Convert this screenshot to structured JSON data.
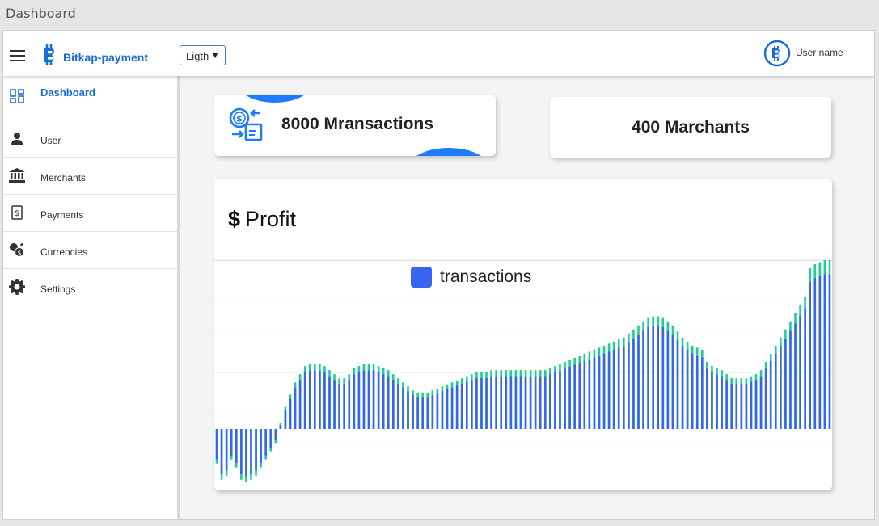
{
  "window": {
    "title": "Dashboard"
  },
  "header": {
    "brand": "Bitkap-payment",
    "theme_select": "Ligth",
    "user_name": "User name"
  },
  "sidebar": {
    "items": [
      {
        "label": "Dashboard",
        "icon": "dashboard-icon",
        "active": true
      },
      {
        "label": "User",
        "icon": "user-icon"
      },
      {
        "label": "Merchants",
        "icon": "bank-icon"
      },
      {
        "label": "Payments",
        "icon": "dollar-bill-icon"
      },
      {
        "label": "Currencies",
        "icon": "currency-exchange-icon"
      },
      {
        "label": "Settings",
        "icon": "gear-icon"
      }
    ]
  },
  "cards": {
    "transactions": "8000 Mransactions",
    "merchants": "400 Marchants"
  },
  "colors": {
    "accent": "#1a6fd6",
    "series_blue": "#3765f2",
    "series_green": "#1fcf8f"
  },
  "chart_data": {
    "type": "bar",
    "title": "Profit",
    "title_prefix": "$",
    "legend": {
      "label": "transactions",
      "position": "top-center"
    },
    "grid": true,
    "ylim": [
      -1.5,
      4.5
    ],
    "series": [
      {
        "name": "transactions",
        "values": [
          -0.8,
          -1.2,
          -1.1,
          -0.7,
          -0.9,
          -1.2,
          -1.25,
          -1.2,
          -1.1,
          -0.9,
          -0.7,
          -0.5,
          -0.3,
          0.1,
          0.5,
          0.8,
          1.1,
          1.3,
          1.5,
          1.55,
          1.55,
          1.55,
          1.5,
          1.4,
          1.3,
          1.2,
          1.2,
          1.3,
          1.45,
          1.5,
          1.55,
          1.55,
          1.55,
          1.5,
          1.45,
          1.4,
          1.3,
          1.2,
          1.1,
          1.0,
          0.9,
          0.85,
          0.85,
          0.85,
          0.9,
          0.95,
          1.0,
          1.05,
          1.1,
          1.15,
          1.2,
          1.25,
          1.3,
          1.35,
          1.35,
          1.35,
          1.4,
          1.4,
          1.4,
          1.4,
          1.4,
          1.4,
          1.4,
          1.4,
          1.4,
          1.4,
          1.4,
          1.4,
          1.45,
          1.5,
          1.55,
          1.6,
          1.65,
          1.7,
          1.75,
          1.8,
          1.85,
          1.9,
          1.95,
          2.0,
          2.05,
          2.1,
          2.15,
          2.2,
          2.3,
          2.4,
          2.5,
          2.6,
          2.7,
          2.72,
          2.72,
          2.7,
          2.6,
          2.5,
          2.35,
          2.2,
          2.1,
          2.0,
          1.95,
          1.9,
          1.6,
          1.5,
          1.45,
          1.4,
          1.3,
          1.2,
          1.2,
          1.2,
          1.2,
          1.25,
          1.3,
          1.4,
          1.6,
          1.8,
          2.0,
          2.2,
          2.4,
          2.6,
          2.8,
          3.0,
          3.2,
          3.9,
          4.0,
          4.05,
          4.1,
          4.1
        ]
      }
    ]
  }
}
